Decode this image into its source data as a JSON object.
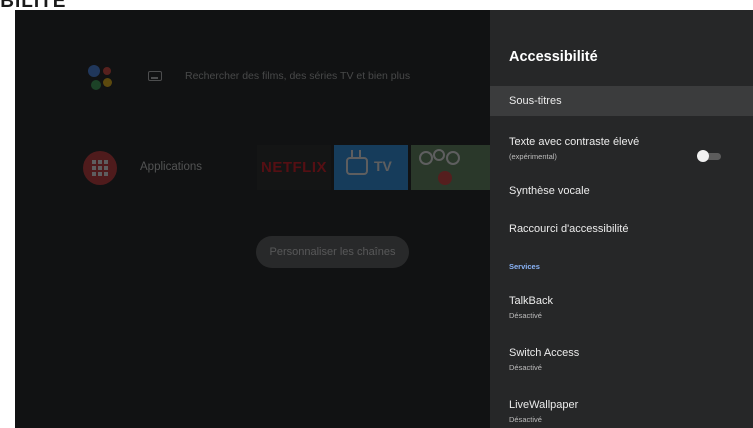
{
  "doc": {
    "heading_fragment": "IBILITE"
  },
  "home": {
    "search_placeholder": "Rechercher des films, des séries TV et bien plus",
    "apps_label": "Applications",
    "netflix_label": "NETFLIX",
    "tv_label": "TV",
    "customize_button": "Personnaliser les chaînes",
    "colors": {
      "apps_icon": "#d32f2f",
      "tv_tile": "#2196f3",
      "netflix_red": "#e50914"
    }
  },
  "panel": {
    "title": "Accessibilité",
    "items": [
      {
        "label": "Sous-titres",
        "focused": true
      },
      {
        "label": "Texte avec contraste élevé",
        "sublabel": "(expérimental)",
        "toggle": "off"
      },
      {
        "label": "Synthèse vocale"
      },
      {
        "label": "Raccourci d'accessibilité"
      }
    ],
    "section_header": "Services",
    "services": [
      {
        "label": "TalkBack",
        "status": "Désactivé"
      },
      {
        "label": "Switch Access",
        "status": "Désactivé"
      },
      {
        "label": "LiveWallpaper",
        "status": "Désactivé"
      }
    ],
    "colors": {
      "background": "#262728",
      "section_accent": "#8ab4f8"
    }
  }
}
